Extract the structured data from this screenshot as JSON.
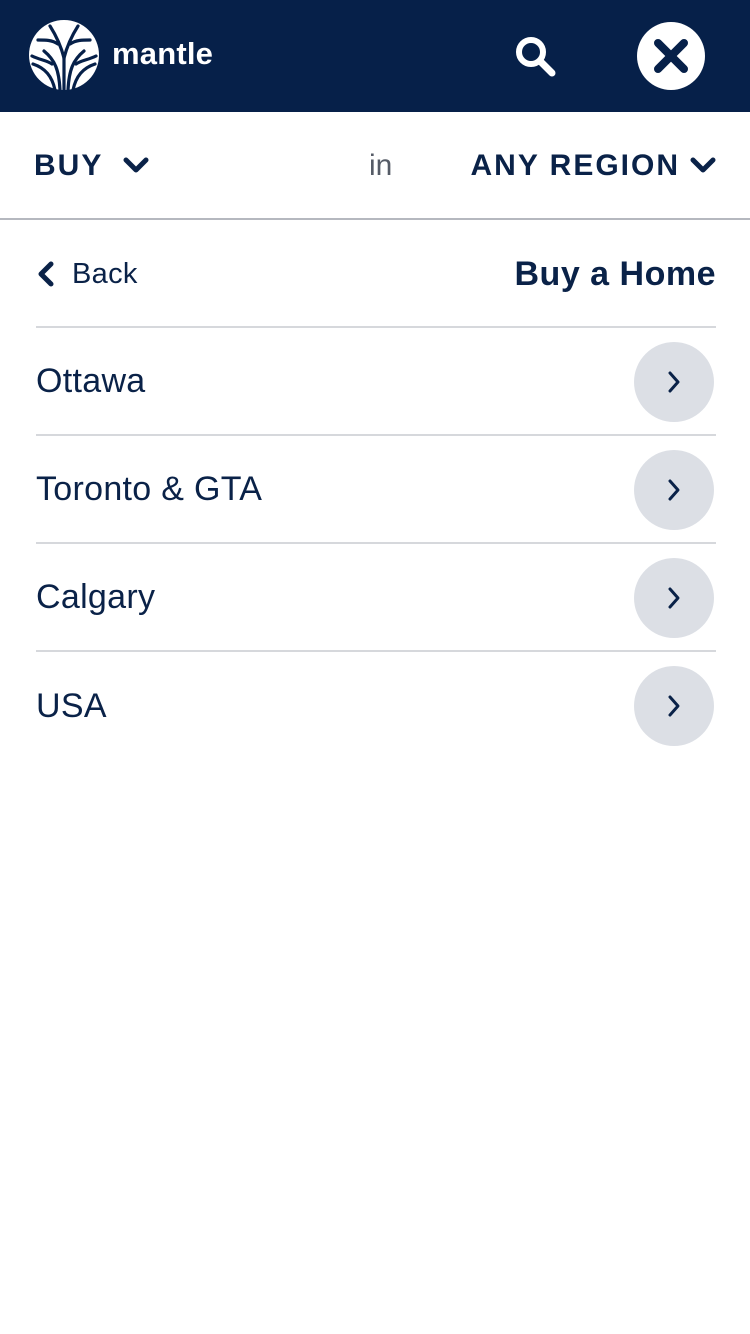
{
  "header": {
    "brand": "mantle",
    "search_icon": "search-icon",
    "close_icon": "close-icon",
    "background_color": "#062049"
  },
  "filter": {
    "type_value": "BUY",
    "connector": "in",
    "region_value": "ANY REGION"
  },
  "subheader": {
    "back_label": "Back",
    "title": "Buy a Home"
  },
  "regions": [
    {
      "label": "Ottawa"
    },
    {
      "label": "Toronto & GTA"
    },
    {
      "label": "Calgary"
    },
    {
      "label": "USA"
    }
  ],
  "colors": {
    "primary": "#0a2248",
    "arrow_circle": "#dcdfe5",
    "divider": "#d6d8dc"
  }
}
